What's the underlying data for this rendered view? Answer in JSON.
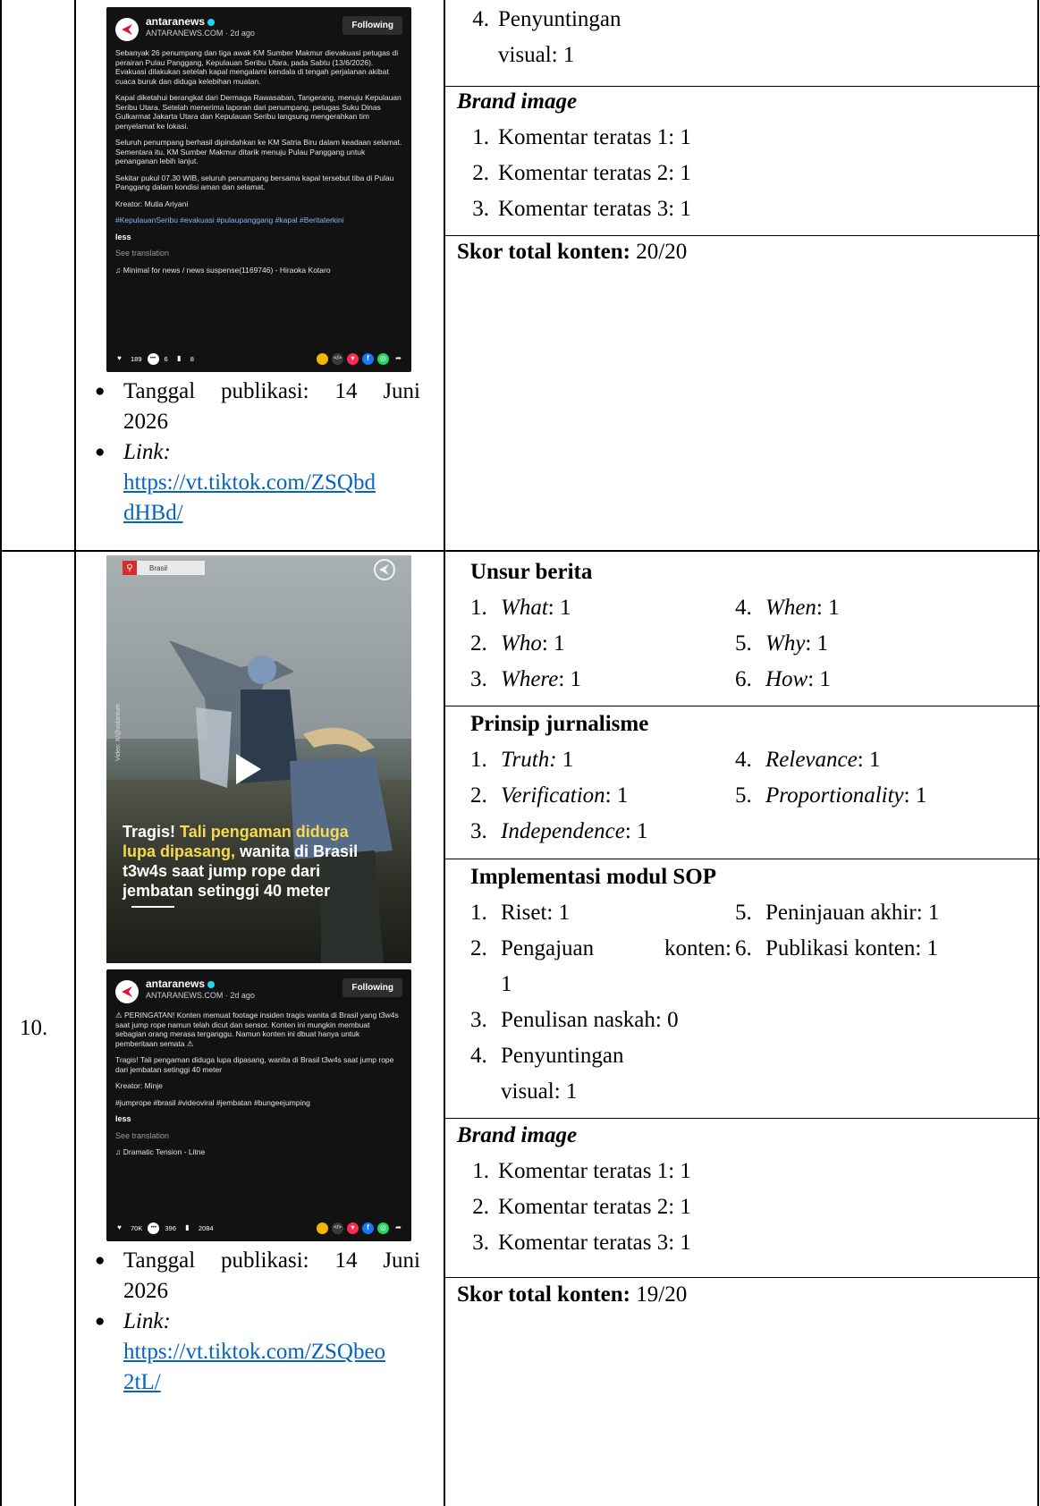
{
  "row9": {
    "post": {
      "account": "antaranews",
      "meta": "ANTARANEWS.COM · 2d ago",
      "follow_label": "Following",
      "paragraphs": [
        "Sebanyak 26 penumpang dan tiga awak KM Sumber Makmur dievakuasi petugas di perairan Pulau Panggang, Kepulauan Seribu Utara, pada Sabtu (13/6/2026). Evakuasi dilakukan setelah kapal mengalami kendala di tengah perjalanan akibat cuaca buruk dan diduga kelebihan muatan.",
        "Kapal diketahui berangkat dari Dermaga Rawasaban, Tangerang, menuju Kepulauan Seribu Utara. Setelah menerima laporan dari penumpang, petugas Suku Dinas Gulkarmat Jakarta Utara dan Kepulauan Seribu langsung mengerahkan tim penyelamat ke lokasi.",
        "Seluruh penumpang berhasil dipindahkan ke KM Satria Biru dalam keadaan selamat. Sementara itu, KM Sumber Makmur ditarik menuju Pulau Panggang untuk penanganan lebih lanjut.",
        "Sekitar pukul 07.30 WIB, seluruh penumpang bersama kapal tersebut tiba di Pulau Panggang dalam kondisi aman dan selamat."
      ],
      "creator": "Kreator: Mutia Ariyani",
      "hashtags": "#KepulauanSeribu #evakuasi #pulaupanggang #kapal #Beritaterkini",
      "less": "less",
      "see_translation": "See translation",
      "music": "Minimal for news / news suspense(1169746) - Hiraoka Kotaro",
      "likes": "189",
      "comments": "6",
      "saves": "8"
    },
    "pub_label": "Tanggal publikasi: 14 Juni 2026",
    "pub_line1": "Tanggal publikasi: 14 Juni",
    "pub_line2": "2026",
    "link_label": "Link:",
    "link_line1": "https://vt.tiktok.com/ZSQbd",
    "link_line2": "dHBd/",
    "editing": {
      "num": "4.",
      "line1": "Penyuntingan",
      "line2": "visual: 1"
    },
    "brand": {
      "title": "Brand image",
      "items": [
        {
          "num": "1.",
          "text": "Komentar teratas 1: 1"
        },
        {
          "num": "2.",
          "text": "Komentar teratas 2: 1"
        },
        {
          "num": "3.",
          "text": "Komentar teratas 3: 1"
        }
      ]
    },
    "score_label": "Skor total konten:",
    "score_value": " 20/20"
  },
  "row10": {
    "number": "10.",
    "video": {
      "location": "Brasil",
      "caption_pre": "Tragis! ",
      "caption_highlight": "Tali pengaman diduga lupa dipasang,",
      "caption_post": " wanita di Brasil t3w4s saat jump rope dari jembatan setinggi 40 meter",
      "credit": "Video: X/@volantum"
    },
    "post": {
      "account": "antaranews",
      "meta": "ANTARANEWS.COM · 2d ago",
      "follow_label": "Following",
      "paragraphs": [
        "⚠ PERINGATAN! Konten memuat footage insiden tragis wanita di Brasil yang t3w4s saat jump rope namun telah dicut dan sensor. Konten ini mungkin membuat sebagian orang merasa terganggu. Namun konten ini dbuat hanya untuk pemberitaan semata ⚠",
        "Tragis! Tali pengaman diduga lupa dipasang, wanita di Brasil t3w4s saat jump rope dari jembatan setinggi 40 meter"
      ],
      "creator": "Kreator: Minje",
      "hashtags": "#jumprope #brasil #videoviral #jembatan #bungeejumping",
      "less": "less",
      "see_translation": "See translation",
      "music": "Dramatic Tension - Litne",
      "likes": "70K",
      "comments": "396",
      "saves": "2084"
    },
    "pub_line1": "Tanggal publikasi: 14 Juni",
    "pub_line2": "2026",
    "link_label": "Link:",
    "link_line1": "https://vt.tiktok.com/ZSQbeo",
    "link_line2": "2tL/",
    "unsur": {
      "title": "Unsur berita",
      "left": [
        {
          "num": "1.",
          "term": "What",
          "val": ": 1"
        },
        {
          "num": "2.",
          "term": "Who",
          "val": ": 1"
        },
        {
          "num": "3.",
          "term": "Where",
          "val": ": 1"
        }
      ],
      "right": [
        {
          "num": "4.",
          "term": "When",
          "val": ": 1"
        },
        {
          "num": "5.",
          "term": "Why",
          "val": ": 1"
        },
        {
          "num": "6.",
          "term": "How",
          "val": ": 1"
        }
      ]
    },
    "prinsip": {
      "title": "Prinsip jurnalisme",
      "left": [
        {
          "num": "1.",
          "term": "Truth:",
          "val": " 1"
        },
        {
          "num": "2.",
          "term": "Verification",
          "val": ": 1"
        },
        {
          "num": "3.",
          "term": "Independence",
          "val": ": 1"
        }
      ],
      "right": [
        {
          "num": "4.",
          "term": "Relevance",
          "val": ": 1"
        },
        {
          "num": "5.",
          "term": "Proportionality",
          "val": ": 1"
        }
      ]
    },
    "sop": {
      "title": "Implementasi modul SOP",
      "i1": {
        "num": "1.",
        "text": "Riset: 1"
      },
      "i5": {
        "num": "5.",
        "text": "Peninjauan akhir: 1"
      },
      "i2": {
        "num": "2.",
        "a": "Pengajuan",
        "b": "konten:",
        "c": "1"
      },
      "i6": {
        "num": "6.",
        "text": "Publikasi konten: 1"
      },
      "i3": {
        "num": "3.",
        "text": "Penulisan naskah: 0"
      },
      "i4": {
        "num": "4.",
        "line1": "Penyuntingan",
        "line2": "visual: 1"
      }
    },
    "brand": {
      "title": "Brand image",
      "items": [
        {
          "num": "1.",
          "text": "Komentar teratas 1: 1"
        },
        {
          "num": "2.",
          "text": "Komentar teratas 2: 1"
        },
        {
          "num": "3.",
          "text": "Komentar teratas 3: 1"
        }
      ]
    },
    "score_label": "Skor total konten:",
    "score_value": " 19/20"
  }
}
